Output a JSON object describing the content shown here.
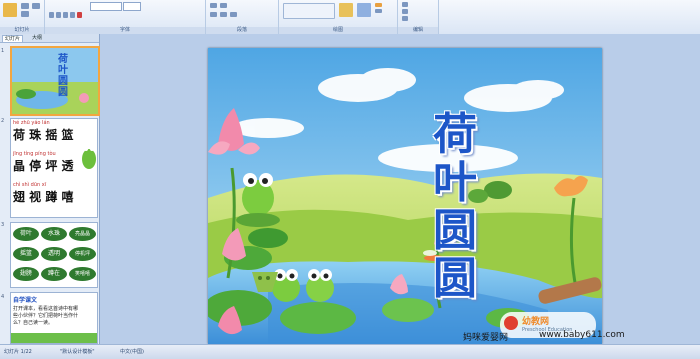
{
  "ribbon": {
    "groups": [
      "幻灯片",
      "字体",
      "段落",
      "绘图",
      "编辑"
    ]
  },
  "outline_panel": {
    "tabs": [
      "幻灯片",
      "大纲"
    ],
    "slides": [
      {
        "number": "1",
        "title": "荷叶圆圆"
      },
      {
        "number": "2",
        "pinyin_rows": [
          "hé  zhū  yáo  lán",
          "jīng tíng píng tòu",
          "chì  shì  dūn  xī"
        ],
        "char_rows": [
          "荷 珠 摇 篮",
          "晶 停 坪 透",
          "翅 视 蹲 嘻"
        ]
      },
      {
        "number": "3",
        "leaves": [
          "荷叶",
          "水珠",
          "亮晶晶",
          "摇篮",
          "透明",
          "停机坪",
          "翅膀",
          "蹲在",
          "笑嘻嘻"
        ]
      },
      {
        "number": "4",
        "heading": "自学课文",
        "lines": [
          "打开课本，看看这首诗中有哪",
          "些小伙伴？它们把荷叶当作什",
          "么？自己读一读。"
        ]
      }
    ]
  },
  "slide": {
    "title_chars": [
      "荷",
      "叶",
      "圆",
      "圆"
    ],
    "logo_text": "幼教网",
    "logo_sub": "Preschool Education"
  },
  "status_bar": {
    "slide_info": "幻灯片 1/22",
    "theme": "\"默认设计模板\"",
    "language": "中文(中国)"
  },
  "watermark": {
    "left": "妈咪爱婴网",
    "right": "www.baby611.com"
  }
}
